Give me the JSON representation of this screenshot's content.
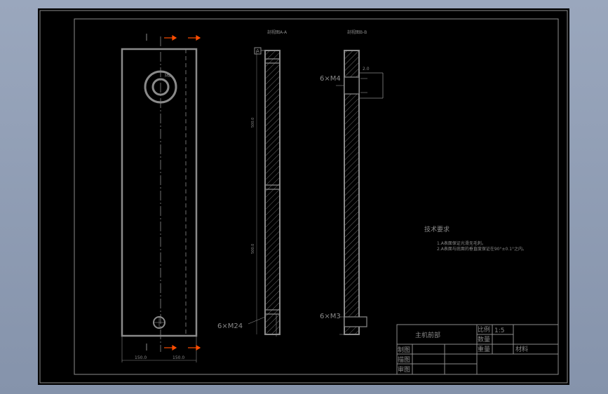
{
  "drawing": {
    "section_a_label": "剖视图A-A",
    "section_b_label": "剖视图B-B",
    "datum_label": "A",
    "hole_callout_m4": "6×M4",
    "hole_callout_m24": "6×M24",
    "hole_callout_m3": "6×M3",
    "tech_title": "技术要求",
    "tech_note_1": "1.A表面保证光滑无毛刺。",
    "tech_note_2": "2.A表面与底面的垂直度保证在90°±0.1°之内。",
    "dim_top": "2.0",
    "dim_bottom_left": "150.0",
    "dim_bottom_right": "150.0",
    "dim_thread": "M8",
    "dim_vertical_1": "500.0",
    "dim_vertical_2": "500.0"
  },
  "title_block": {
    "part_name": "主机前部",
    "scale_label": "比例",
    "scale_value": "1:5",
    "quantity_label": "数量",
    "weight_label": "重量",
    "material_label": "材料",
    "drawn_label": "制图",
    "traced_label": "描图",
    "checked_label": "审图"
  },
  "colors": {
    "background": "#000000",
    "frame": "#8c8c8c",
    "arrow": "#ff4d00"
  }
}
